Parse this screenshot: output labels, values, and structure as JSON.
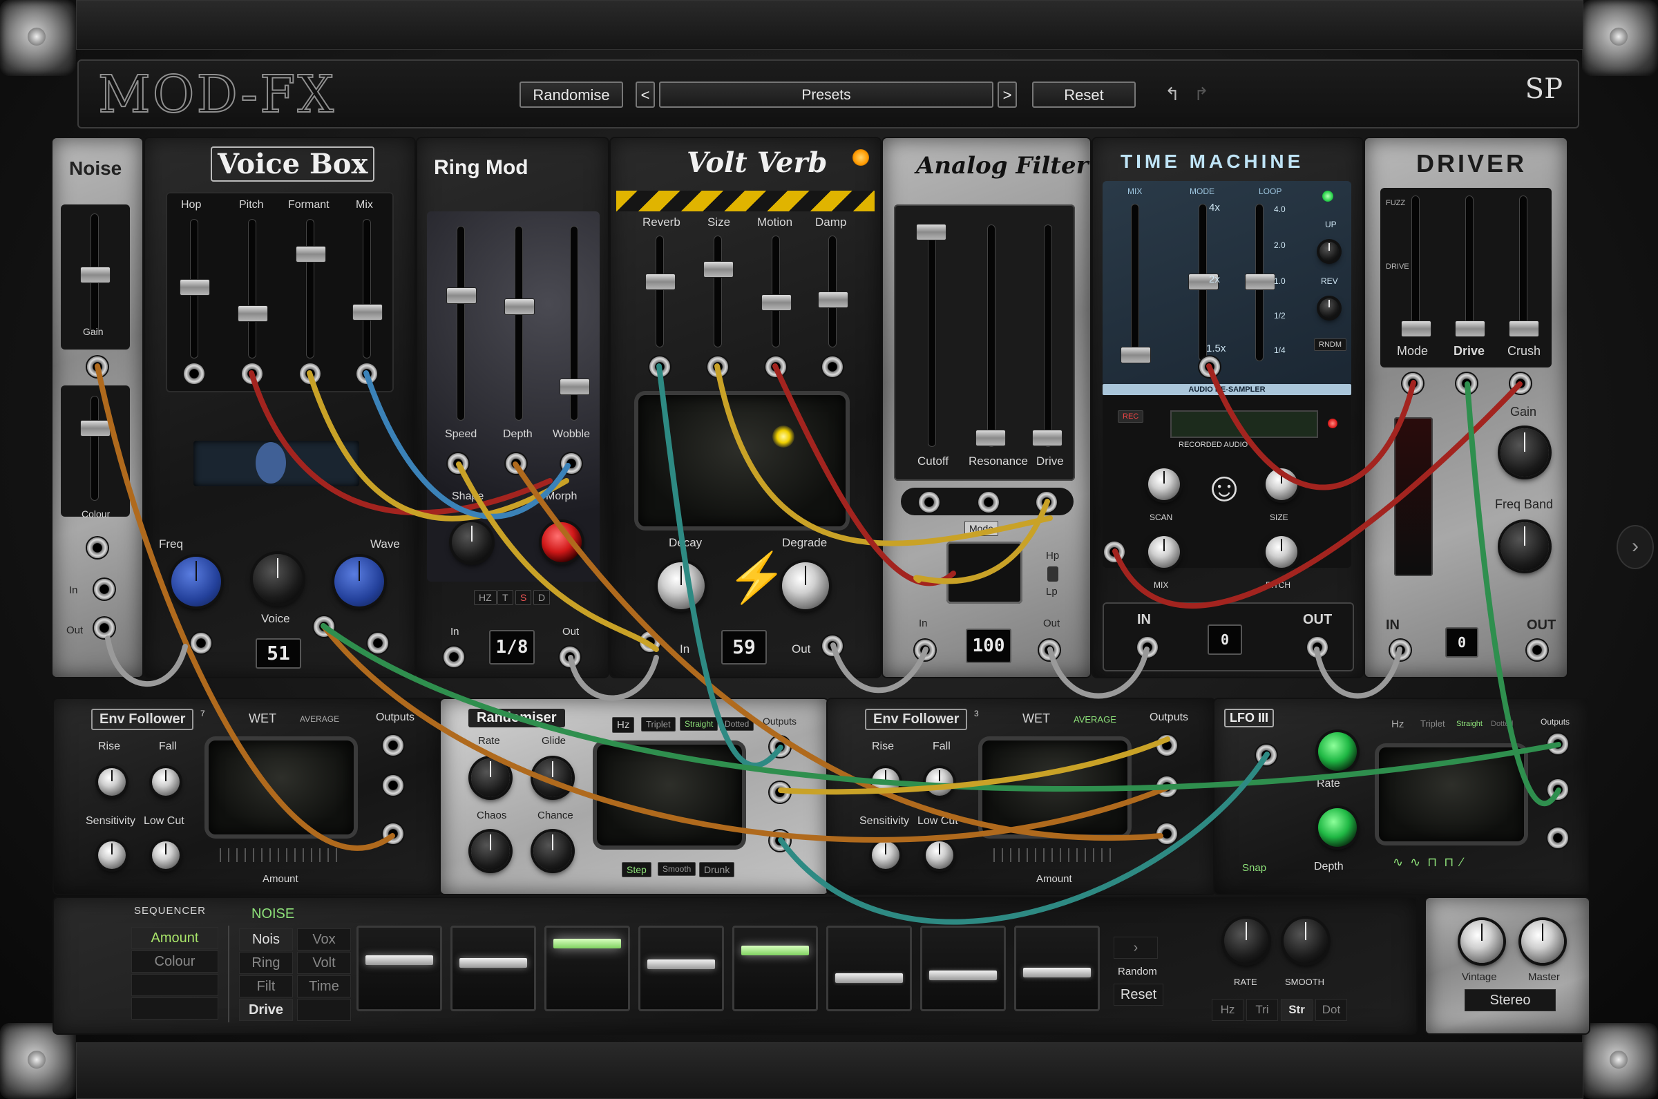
{
  "header": {
    "logo": "MOD-FX",
    "randomise_label": "Randomise",
    "prev_label": "<",
    "presets_label": "Presets",
    "next_label": ">",
    "reset_label": "Reset",
    "brand_mark": "SP"
  },
  "modules": {
    "noise": {
      "title": "Noise",
      "gain": "Gain",
      "colour": "Colour",
      "in": "In",
      "out": "Out"
    },
    "voicebox": {
      "title": "Voice Box",
      "hop": "Hop",
      "pitch": "Pitch",
      "formant": "Formant",
      "mix": "Mix",
      "freq": "Freq",
      "wave": "Wave",
      "voice": "Voice",
      "display": "51"
    },
    "ringmod": {
      "title": "Ring Mod",
      "speed": "Speed",
      "depth": "Depth",
      "wobble": "Wobble",
      "shape": "Shape",
      "morph": "Morph",
      "in": "In",
      "out": "Out",
      "display": "1/8",
      "modes": [
        "HZ",
        "T",
        "S",
        "D"
      ]
    },
    "voltverb": {
      "title": "Volt Verb",
      "reverb": "Reverb",
      "size": "Size",
      "motion": "Motion",
      "damp": "Damp",
      "decay": "Decay",
      "degrade": "Degrade",
      "in": "In",
      "out": "Out",
      "display": "59"
    },
    "analogfilter": {
      "title": "Analog Filter",
      "cutoff": "Cutoff",
      "resonance": "Resonance",
      "drive": "Drive",
      "mode": "Mode",
      "hp": "Hp",
      "lp": "Lp",
      "in": "In",
      "out": "Out",
      "display": "100"
    },
    "timemachine": {
      "title": "TIME MACHINE",
      "mix": "MIX",
      "mode": "MODE",
      "loop": "LOOP",
      "mode_marks": [
        "4x",
        "2x",
        "1.5x"
      ],
      "loop_marks": [
        "4.0",
        "2.0",
        "1.0",
        "1/2",
        "1/4"
      ],
      "up": "UP",
      "rev": "REV",
      "rndm": "RNDM",
      "sampler_title": "AUDIO RE-SAMPLER",
      "rec": "REC",
      "recorded_audio": "RECORDED AUDIO",
      "scan": "SCAN",
      "size": "SIZE",
      "mix2": "MIX",
      "pitch": "PITCH",
      "in": "IN",
      "out": "OUT",
      "display_in": "0"
    },
    "driver": {
      "title": "DRIVER",
      "fuzz": "FUZZ",
      "drive_mark": "DRIVE",
      "mode": "Mode",
      "drive": "Drive",
      "crush": "Crush",
      "gain": "Gain",
      "freq_band": "Freq Band",
      "in": "IN",
      "out": "OUT",
      "display": "0"
    }
  },
  "bottom": {
    "env1": {
      "title": "Env Follower",
      "index": "7",
      "wet": "WET",
      "average": "AVERAGE",
      "outputs": "Outputs",
      "rise": "Rise",
      "fall": "Fall",
      "sensitivity": "Sensitivity",
      "low_cut": "Low Cut",
      "amount": "Amount"
    },
    "randomiser": {
      "title": "Randomiser",
      "rate": "Rate",
      "glide": "Glide",
      "chaos": "Chaos",
      "chance": "Chance",
      "hz": "Hz",
      "triplet": "Triplet",
      "straight": "Straight",
      "dotted": "Dotted",
      "outputs": "Outputs",
      "step": "Step",
      "smooth": "Smooth",
      "drunk": "Drunk"
    },
    "env2": {
      "title": "Env Follower",
      "index": "3",
      "wet": "WET",
      "average": "AVERAGE",
      "outputs": "Outputs",
      "rise": "Rise",
      "fall": "Fall",
      "sensitivity": "Sensitivity",
      "low_cut": "Low Cut",
      "amount": "Amount"
    },
    "lfo": {
      "title": "LFO III",
      "rate": "Rate",
      "depth": "Depth",
      "snap": "Snap",
      "hz": "Hz",
      "triplet": "Triplet",
      "straight": "Straight",
      "dotted": "Dotted",
      "outputs": "Outputs"
    }
  },
  "sequencer": {
    "title": "SEQUENCER",
    "targets": [
      "Amount",
      "Colour"
    ],
    "selected_module": "NOISE",
    "modules": [
      [
        "Nois",
        "Vox"
      ],
      [
        "Ring",
        "Volt"
      ],
      [
        "Filt",
        "Time"
      ],
      [
        "Drive",
        ""
      ]
    ],
    "steps": [
      0.62,
      0.58,
      0.92,
      0.55,
      0.8,
      0.3,
      0.35,
      0.4
    ],
    "random_label": "Random",
    "reset_label": "Reset",
    "rate": "RATE",
    "smooth": "SMOOTH",
    "rate_modes": [
      "Hz",
      "Tri",
      "Str",
      "Dot"
    ],
    "vintage": "Vintage",
    "master": "Master",
    "stereo": "Stereo"
  },
  "colors": {
    "cable_yellow": "#c9a227",
    "cable_red": "#a3241f",
    "cable_blue": "#3b82b8",
    "cable_teal": "#2e8a83",
    "cable_orange": "#b06a1d",
    "cable_green": "#2f8f4e",
    "led_green": "#5cff7a",
    "led_amber": "#ffb020"
  }
}
